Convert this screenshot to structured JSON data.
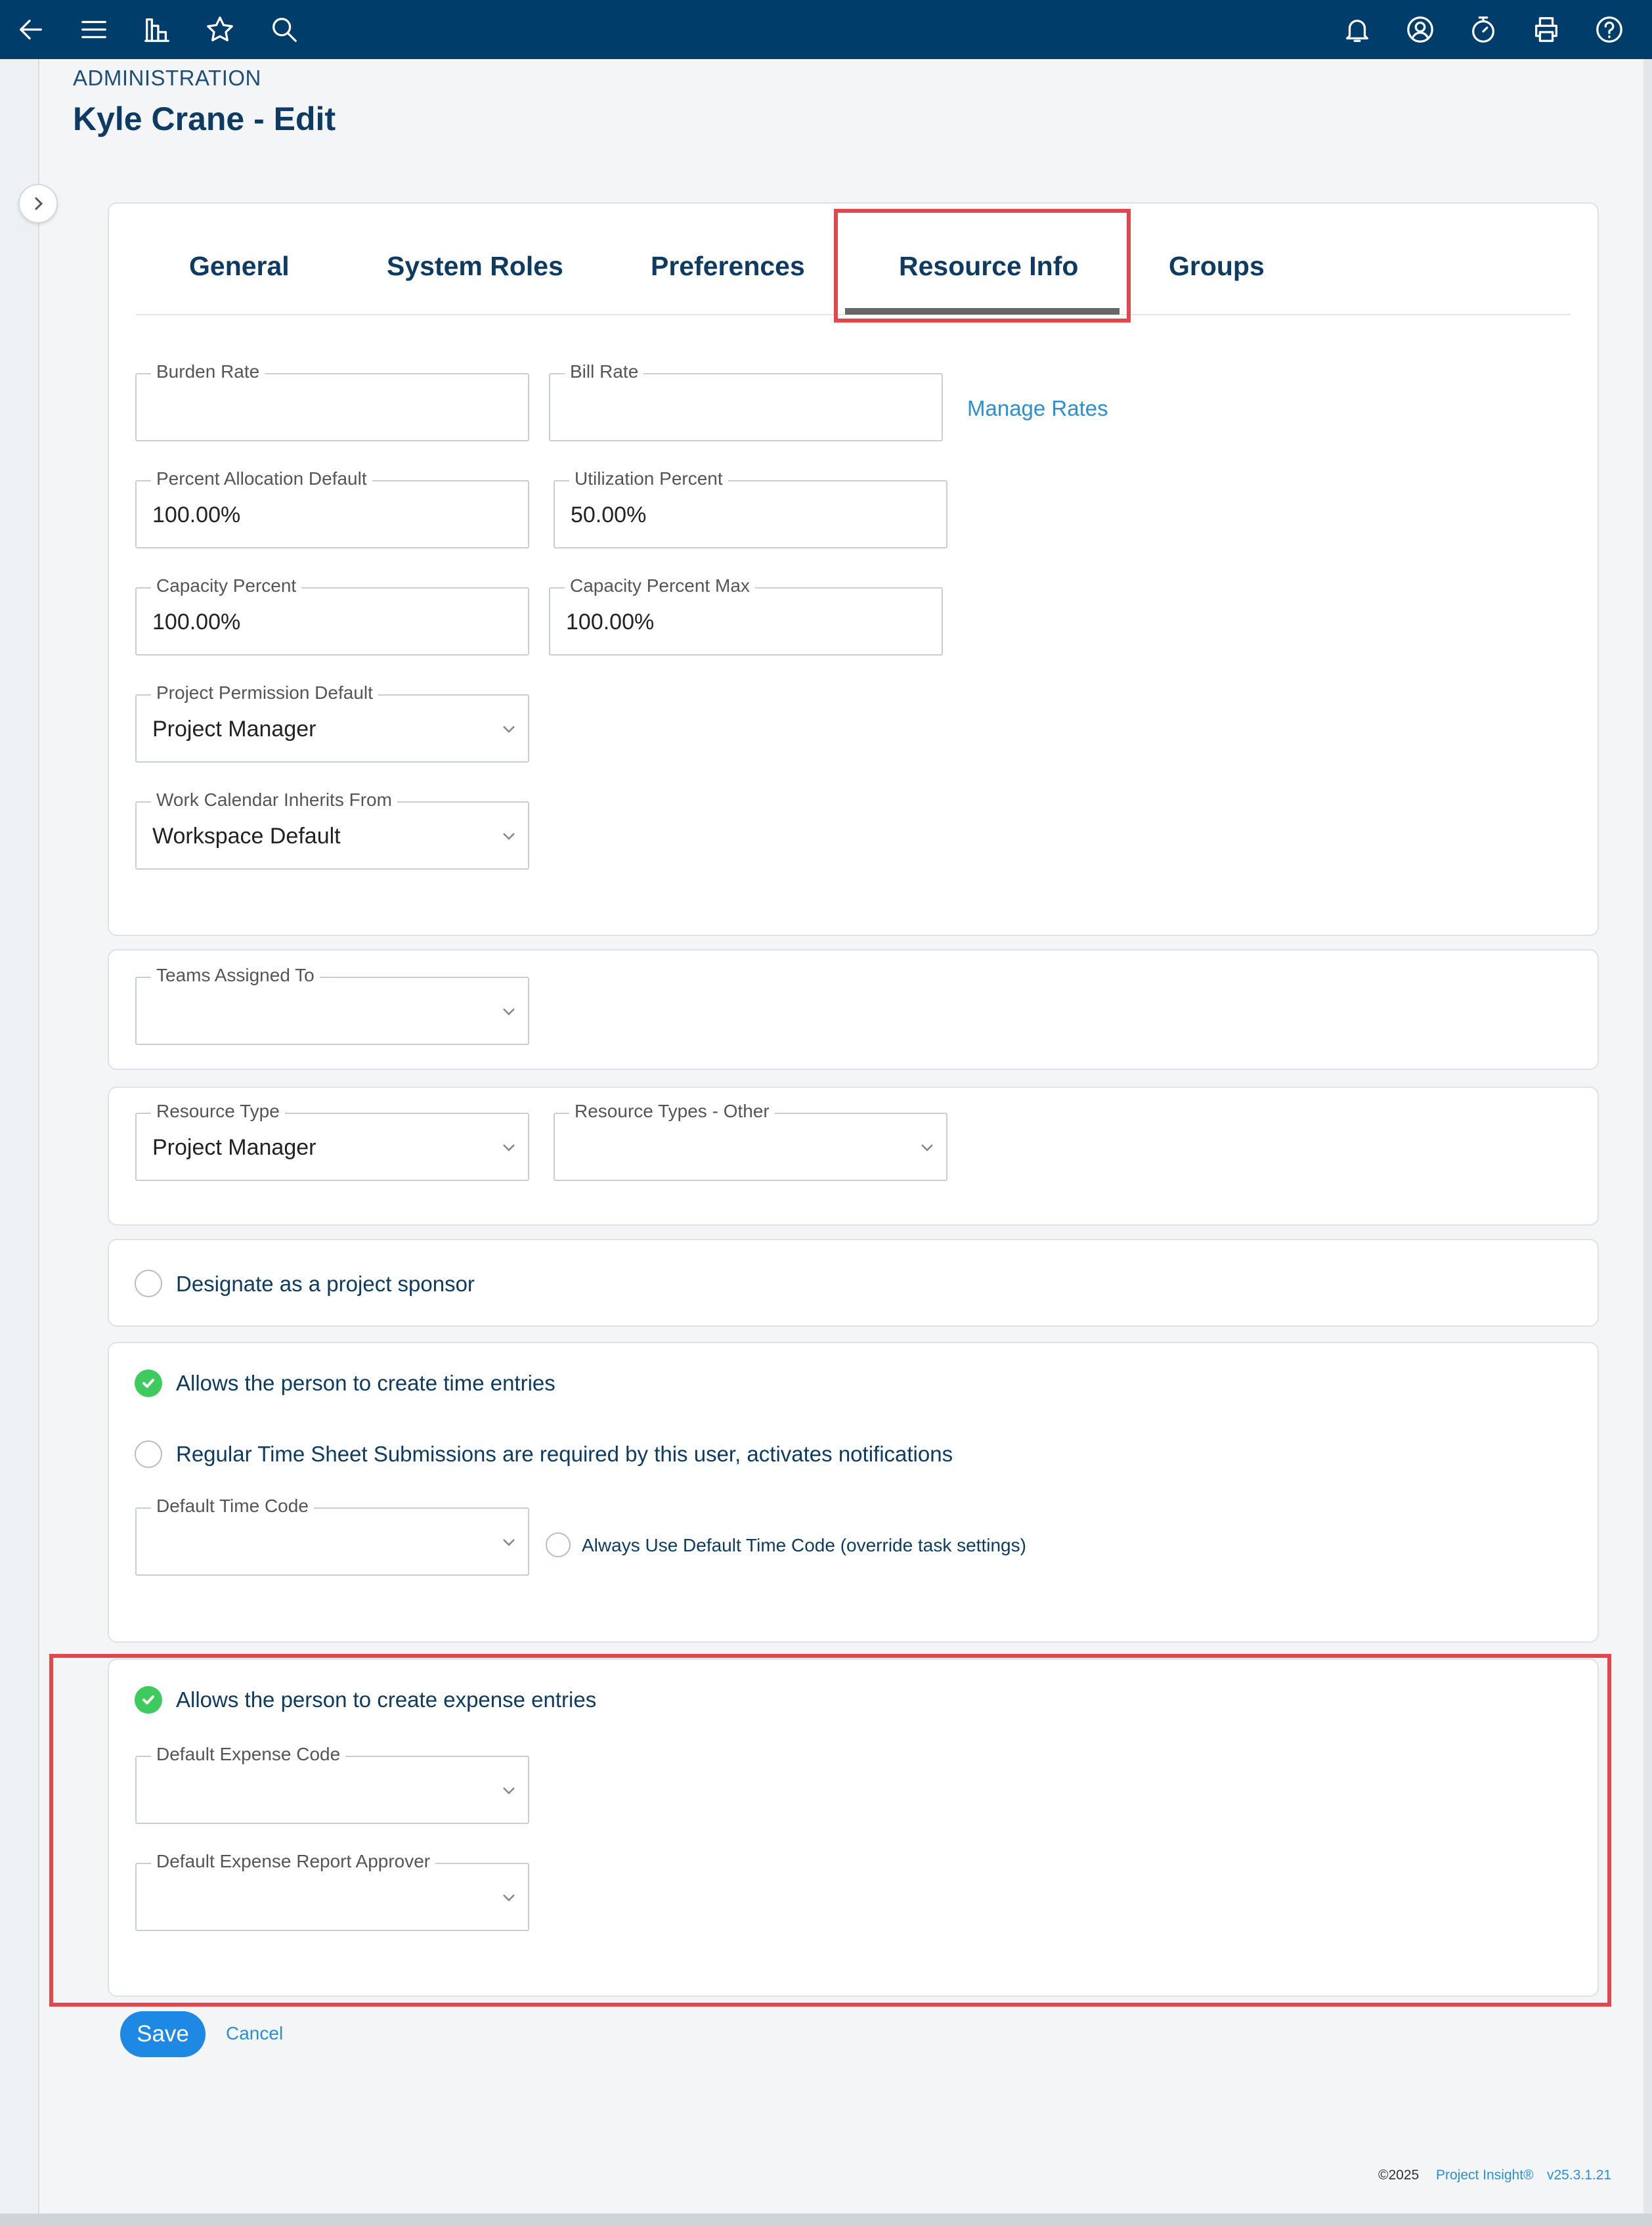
{
  "header": {
    "icons": [
      "back-arrow-icon",
      "menu-icon",
      "reports-icon",
      "star-icon",
      "search-icon",
      "bell-icon",
      "user-icon",
      "stopwatch-icon",
      "printer-icon",
      "help-icon"
    ]
  },
  "breadcrumb": "ADMINISTRATION",
  "title": "Kyle Crane - Edit",
  "tabs": [
    {
      "label": "General"
    },
    {
      "label": "System Roles"
    },
    {
      "label": "Preferences"
    },
    {
      "label": "Resource Info",
      "active": true
    },
    {
      "label": "Groups"
    }
  ],
  "rates": {
    "burden_rate": {
      "label": "Burden Rate",
      "value": ""
    },
    "bill_rate": {
      "label": "Bill Rate",
      "value": ""
    },
    "manage_rates": "Manage Rates",
    "percent_allocation_default": {
      "label": "Percent Allocation Default",
      "value": "100.00%"
    },
    "utilization_percent": {
      "label": "Utilization Percent",
      "value": "50.00%"
    },
    "capacity_percent": {
      "label": "Capacity Percent",
      "value": "100.00%"
    },
    "capacity_percent_max": {
      "label": "Capacity Percent Max",
      "value": "100.00%"
    },
    "project_permission_default": {
      "label": "Project Permission Default",
      "value": "Project Manager"
    },
    "work_calendar": {
      "label": "Work Calendar Inherits From",
      "value": "Workspace Default"
    }
  },
  "teams": {
    "label": "Teams Assigned To",
    "value": ""
  },
  "resource_type": {
    "label": "Resource Type",
    "value": "Project Manager"
  },
  "resource_types_other": {
    "label": "Resource Types - Other",
    "value": ""
  },
  "sponsor": {
    "label": "Designate as a project sponsor",
    "checked": false
  },
  "time": {
    "create_time_entries": {
      "label": "Allows the person to create time entries",
      "checked": true
    },
    "timesheet_required": {
      "label": "Regular Time Sheet Submissions are required by this user, activates notifications",
      "checked": false
    },
    "default_time_code": {
      "label": "Default Time Code",
      "value": ""
    },
    "always_use_default": {
      "label": "Always Use Default Time Code (override task settings)",
      "checked": false
    }
  },
  "expense": {
    "create_expense_entries": {
      "label": "Allows the person to create expense entries",
      "checked": true
    },
    "default_expense_code": {
      "label": "Default Expense Code",
      "value": ""
    },
    "default_expense_approver": {
      "label": "Default Expense Report Approver",
      "value": ""
    }
  },
  "actions": {
    "save": "Save",
    "cancel": "Cancel"
  },
  "footer": {
    "copyright": "©2025",
    "product": "Project Insight®",
    "version": "v25.3.1.21"
  },
  "colors": {
    "topbar": "#003d6b",
    "accent": "#1e88e5",
    "check": "#3ecb5e",
    "highlight": "#e3474c"
  }
}
